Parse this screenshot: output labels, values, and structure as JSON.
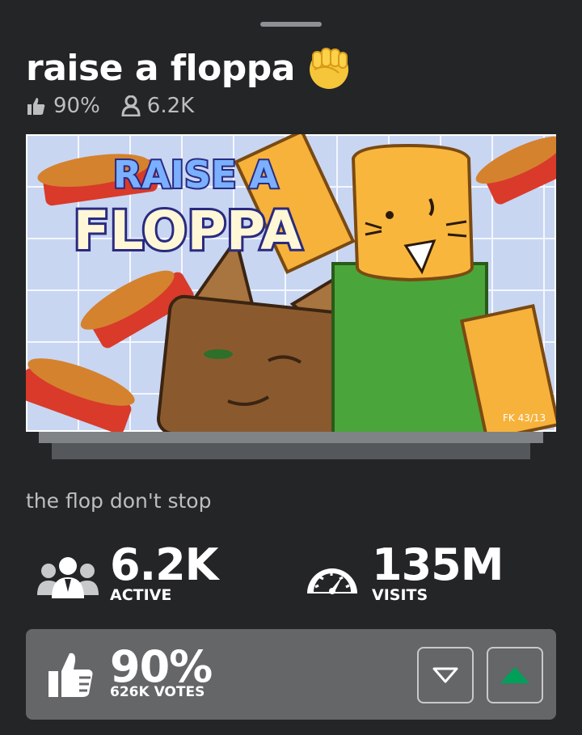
{
  "game": {
    "title": "raise a floppa",
    "title_emoji_icon": "raised-fist-icon",
    "rating_percent": "90%",
    "players_short": "6.2K",
    "description": "the flop don't stop"
  },
  "thumbnail": {
    "banner_line1": "RAISE A",
    "banner_line2": "FLOPPA",
    "signature": "FK 43/13"
  },
  "stats": {
    "active": {
      "value": "6.2K",
      "label": "ACTIVE",
      "icon": "people-icon"
    },
    "visits": {
      "value": "135M",
      "label": "VISITS",
      "icon": "speedometer-icon"
    }
  },
  "votes": {
    "percent": "90%",
    "count_label": "626K VOTES",
    "icon": "thumbs-up-icon",
    "colors": {
      "upvote_active": "#00a05a",
      "panel": "#646668"
    }
  },
  "colors": {
    "background": "#232527",
    "muted_text": "#bdbec0"
  }
}
